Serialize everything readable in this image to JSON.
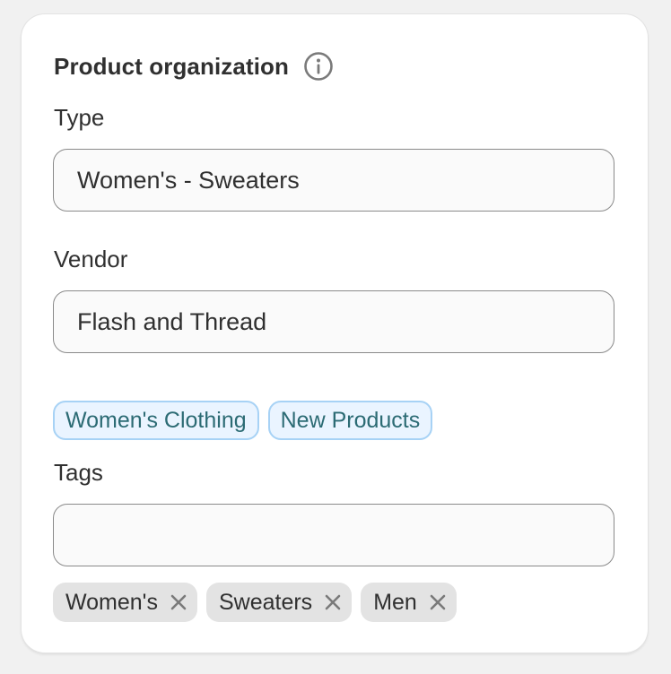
{
  "section": {
    "title": "Product organization",
    "info_icon": "info-circle-icon"
  },
  "type_field": {
    "label": "Type",
    "value": "Women's - Sweaters"
  },
  "vendor_field": {
    "label": "Vendor",
    "value": "Flash and Thread"
  },
  "suggested_tags": [
    {
      "label": "Women's Clothing"
    },
    {
      "label": "New Products"
    }
  ],
  "tags_field": {
    "label": "Tags",
    "value": ""
  },
  "tags": [
    {
      "label": "Women's",
      "remove_icon": "close-icon"
    },
    {
      "label": "Sweaters",
      "remove_icon": "close-icon"
    },
    {
      "label": "Men",
      "remove_icon": "close-icon"
    }
  ],
  "colors": {
    "page_background": "#f1f1f1",
    "card_background": "#ffffff",
    "suggestion_background": "#eaf4ff",
    "suggestion_border": "#a7d2f5",
    "suggestion_text": "#2c6b74",
    "tag_background": "#e3e3e3",
    "icon_gray": "#7a7a7a"
  }
}
